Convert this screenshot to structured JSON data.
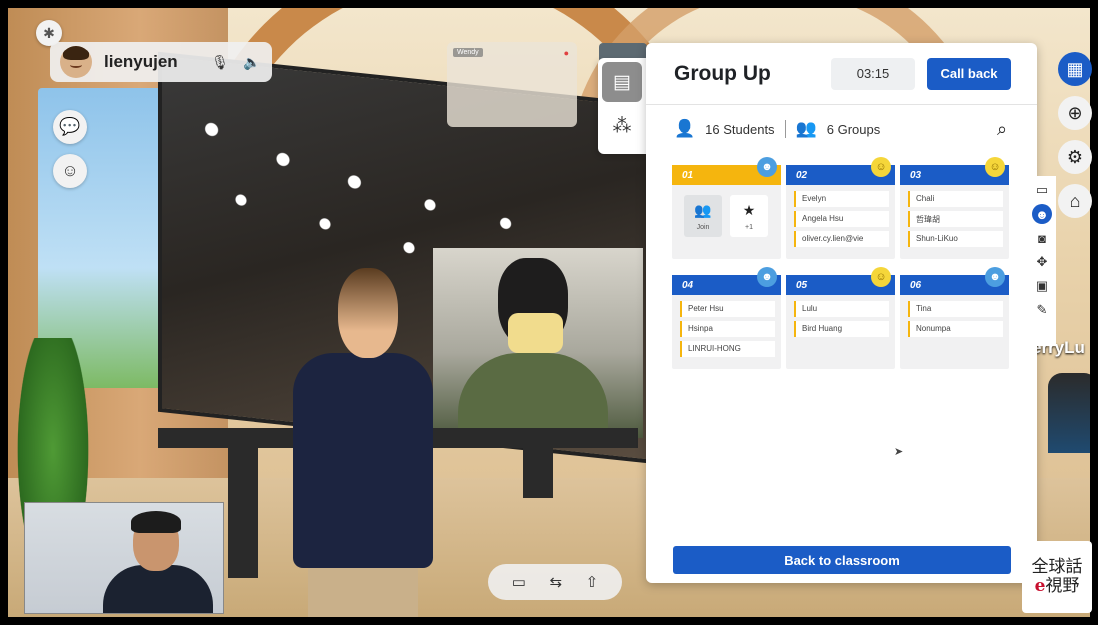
{
  "user": {
    "name": "lienyujen"
  },
  "video_tiles": {
    "wendy_label": "Wendy"
  },
  "panel": {
    "title": "Group Up",
    "timer": "03:15",
    "call_back_label": "Call back",
    "students_label": "16 Students",
    "groups_label": "6 Groups",
    "back_label": "Back to classroom"
  },
  "groups": [
    {
      "id": "01",
      "actions": [
        {
          "label": "Join",
          "icon": "people-icon"
        },
        {
          "label": "+1",
          "icon": "star-icon"
        }
      ]
    },
    {
      "id": "02",
      "members": [
        "Evelyn",
        "Angela Hsu",
        "oliver.cy.lien@vie"
      ]
    },
    {
      "id": "03",
      "members": [
        "Chali",
        "哲瑋胡",
        "Shun-LiKuo"
      ]
    },
    {
      "id": "04",
      "members": [
        "Peter Hsu",
        "Hsinpa",
        "LINRUI-HONG"
      ]
    },
    {
      "id": "05",
      "members": [
        "Lulu",
        "Bird Huang"
      ]
    },
    {
      "id": "06",
      "members": [
        "Tina",
        "Nonumpa"
      ]
    }
  ],
  "scene": {
    "right_name_partial": "erryLu"
  },
  "logo": {
    "line1": "全球話",
    "line2_e": "e",
    "line2": "視野"
  },
  "colors": {
    "primary": "#1b5cc6",
    "accent_yellow": "#f5b50e"
  }
}
